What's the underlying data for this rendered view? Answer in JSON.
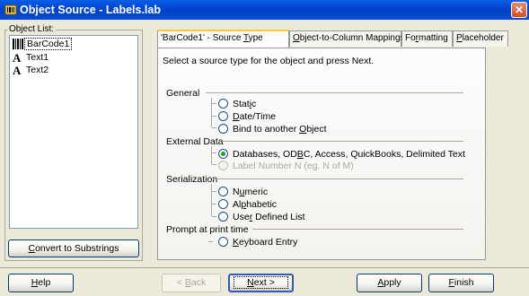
{
  "window": {
    "title": "Object Source - Labels.lab",
    "close_glyph": "✕"
  },
  "object_list": {
    "legend": "Object List:",
    "items": [
      {
        "label": "BarCode1",
        "icon": "barcode-icon"
      },
      {
        "label": "Text1",
        "icon": "text-a-icon"
      },
      {
        "label": "Text2",
        "icon": "text-a-icon"
      }
    ],
    "convert_button": {
      "pre": "",
      "u": "C",
      "post": "onvert to Substrings"
    }
  },
  "tabs": [
    {
      "pre": "'BarCode1' - Source ",
      "u": "T",
      "post": "ype",
      "active": true
    },
    {
      "pre": "",
      "u": "O",
      "post": "bject-to-Column Mappings",
      "active": false
    },
    {
      "pre": "Fo",
      "u": "r",
      "post": "matting",
      "active": false
    },
    {
      "pre": "",
      "u": "P",
      "post": "laceholder",
      "active": false
    }
  ],
  "panel": {
    "instruction": "Select a source type for the object and press Next.",
    "groups": [
      {
        "title": "General",
        "options": [
          {
            "pre": "Stat",
            "u": "i",
            "post": "c",
            "checked": false,
            "disabled": false
          },
          {
            "pre": "",
            "u": "D",
            "post": "ate/Time",
            "checked": false,
            "disabled": false
          },
          {
            "pre": "Bind to another ",
            "u": "O",
            "post": "bject",
            "checked": false,
            "disabled": false
          }
        ]
      },
      {
        "title": "External Data",
        "options": [
          {
            "pre": "Databases, OD",
            "u": "B",
            "post": "C, Access, QuickBooks, Delimited Text",
            "checked": true,
            "disabled": false
          },
          {
            "pre": "Label Number N (eg. N of M)",
            "u": "",
            "post": "",
            "checked": false,
            "disabled": true
          }
        ]
      },
      {
        "title": "Serialization",
        "options": [
          {
            "pre": "N",
            "u": "u",
            "post": "meric",
            "checked": false,
            "disabled": false
          },
          {
            "pre": "Al",
            "u": "p",
            "post": "habetic",
            "checked": false,
            "disabled": false
          },
          {
            "pre": "Use",
            "u": "r",
            "post": " Defined List",
            "checked": false,
            "disabled": false
          }
        ]
      },
      {
        "title": "Prompt at print time",
        "options": [
          {
            "pre": "",
            "u": "K",
            "post": "eyboard Entry",
            "checked": false,
            "disabled": false
          }
        ]
      }
    ]
  },
  "buttons": {
    "help": {
      "pre": "",
      "u": "H",
      "post": "elp"
    },
    "back": {
      "pre": "< ",
      "u": "B",
      "post": "ack"
    },
    "next": {
      "pre": "",
      "u": "N",
      "post": "ext >"
    },
    "apply": {
      "pre": "",
      "u": "A",
      "post": "pply"
    },
    "finish": {
      "pre": "",
      "u": "F",
      "post": "inish"
    }
  },
  "colors": {
    "title_bar": "#0346D0",
    "dialog_bg": "#ECE9D8",
    "active_tab_highlight": "#FFC83C",
    "radio_dot": "#21A121"
  }
}
